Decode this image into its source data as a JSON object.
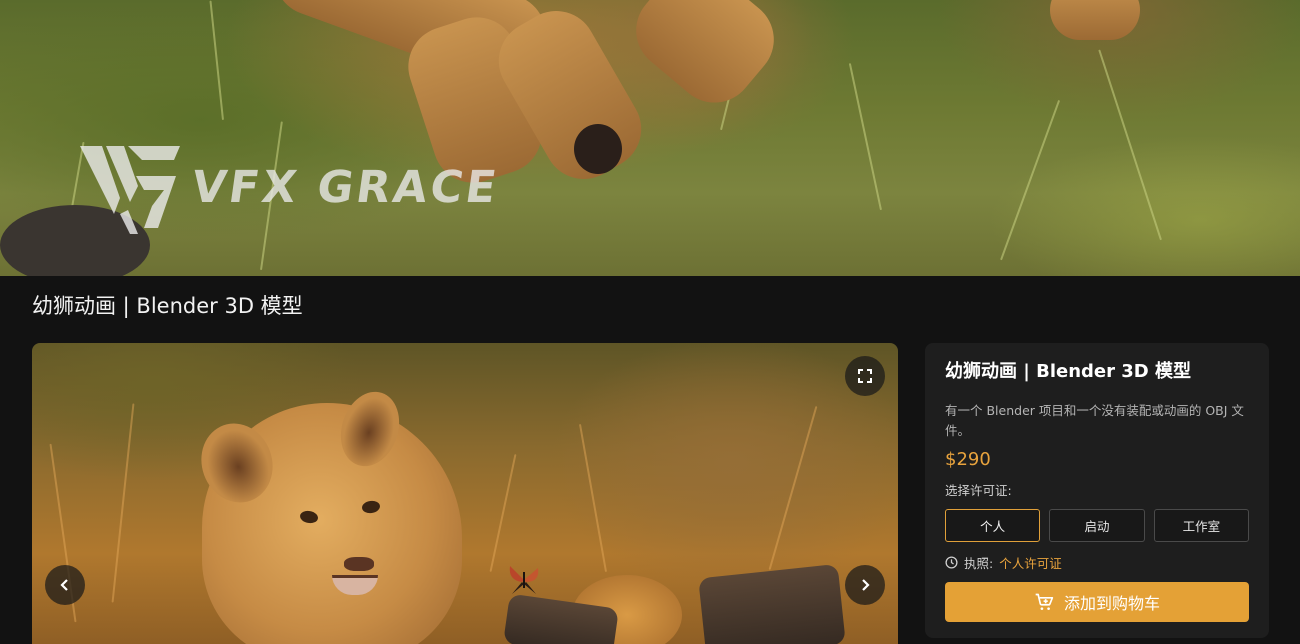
{
  "hero": {
    "logo_text": "VFX GRACE",
    "logo_icon": "vg-logo-icon"
  },
  "page": {
    "title": "幼狮动画 | Blender 3D 模型"
  },
  "viewer": {
    "fullscreen_icon": "fullscreen-icon",
    "prev_icon": "chevron-left-icon",
    "next_icon": "chevron-right-icon"
  },
  "product": {
    "title": "幼狮动画 | Blender 3D 模型",
    "description": "有一个 Blender 项目和一个没有装配或动画的 OBJ 文件。",
    "price": "$290",
    "license_label": "选择许可证:",
    "license_options": [
      {
        "label": "个人",
        "selected": true
      },
      {
        "label": "启动",
        "selected": false
      },
      {
        "label": "工作室",
        "selected": false
      }
    ],
    "license_info_label": "执照:",
    "license_info_value": "个人许可证",
    "add_to_cart": "添加到购物车"
  },
  "colors": {
    "accent": "#e4a136",
    "background": "#121212",
    "panel": "#1e1e1e"
  }
}
